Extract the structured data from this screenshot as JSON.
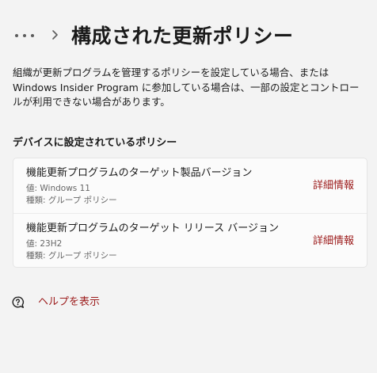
{
  "header": {
    "title": "構成された更新ポリシー"
  },
  "description": "組織が更新プログラムを管理するポリシーを設定している場合、または Windows Insider Program に参加している場合は、一部の設定とコントロールが利用できない場合があります。",
  "section_title": "デバイスに設定されているポリシー",
  "policies": [
    {
      "name": "機能更新プログラムのターゲット製品バージョン",
      "value": "値: Windows 11",
      "kind": "種類: グループ ポリシー",
      "link": "詳細情報"
    },
    {
      "name": "機能更新プログラムのターゲット リリース バージョン",
      "value": "値: 23H2",
      "kind": "種類: グループ ポリシー",
      "link": "詳細情報"
    }
  ],
  "help": {
    "label": "ヘルプを表示",
    "icon": "help-chat-icon"
  },
  "icons": {
    "more": "more-icon",
    "chevron": "chevron-right-icon"
  },
  "colors": {
    "background": "#f3f3f3",
    "card": "#fbfbfb",
    "accent_link": "#9c1b1b",
    "secondary_text": "#666666"
  }
}
